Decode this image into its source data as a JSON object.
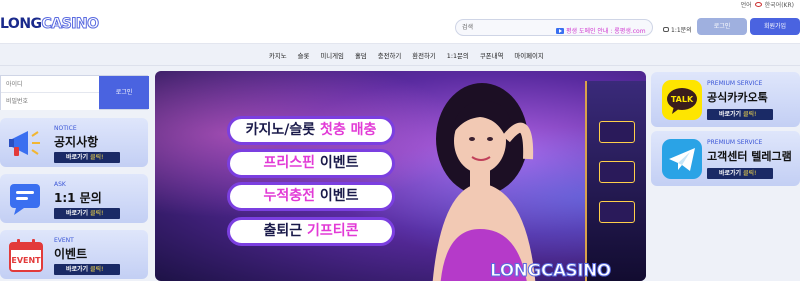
{
  "topbar": {
    "lang_label": "언어",
    "lang_value": "한국어(KR)"
  },
  "header": {
    "logo_part1": "LONG",
    "logo_part2": "CASINO",
    "search_placeholder": "검색",
    "notice_text": "평생 도메인 안내 : 롱평생.com",
    "qna_label": "1:1문의",
    "login_label": "로그인",
    "join_label": "회원가입"
  },
  "nav": [
    "카지노",
    "슬롯",
    "미니게임",
    "홀덤",
    "충전하기",
    "환전하기",
    "1:1문의",
    "쿠폰내역",
    "마이페이지"
  ],
  "login": {
    "id_placeholder": "아이디",
    "pw_placeholder": "비밀번호",
    "submit_label": "로그인"
  },
  "left_cards": [
    {
      "eng": "NOTICE",
      "kor": "공지사항",
      "go": "바로가기",
      "click": "클릭!",
      "icon": "megaphone-icon"
    },
    {
      "eng": "ASK",
      "kor": "1:1 문의",
      "go": "바로가기",
      "click": "클릭!",
      "icon": "chat-icon"
    },
    {
      "eng": "EVENT",
      "kor": "이벤트",
      "go": "바로가기",
      "click": "클릭!",
      "icon": "event-calendar-icon",
      "icon_text": "EVENT"
    }
  ],
  "banner": {
    "promos": [
      {
        "text": "카지노/슬롯 ",
        "highlight": "첫충 매충"
      },
      {
        "text": "",
        "highlight": "프리스핀",
        "after": " 이벤트"
      },
      {
        "text": "",
        "highlight": "누적충전",
        "after": " 이벤트"
      },
      {
        "text": "출퇴근 ",
        "highlight": "기프티콘"
      }
    ],
    "logo_part1": "LONG",
    "logo_part2": "CASINO"
  },
  "right_cards": [
    {
      "eng": "PREMIUM SERVICE",
      "kor": "공식카카오톡",
      "go": "바로가기",
      "click": "클릭!",
      "icon": "kakaotalk-icon",
      "icon_text": "TALK"
    },
    {
      "eng": "PREMIUM SERVICE",
      "kor": "고객센터 텔레그램",
      "go": "바로가기",
      "click": "클릭!",
      "icon": "telegram-icon"
    }
  ],
  "colors": {
    "accent": "#4a63e0",
    "dark_navy": "#1a2a66",
    "highlight": "#e23ad6"
  }
}
